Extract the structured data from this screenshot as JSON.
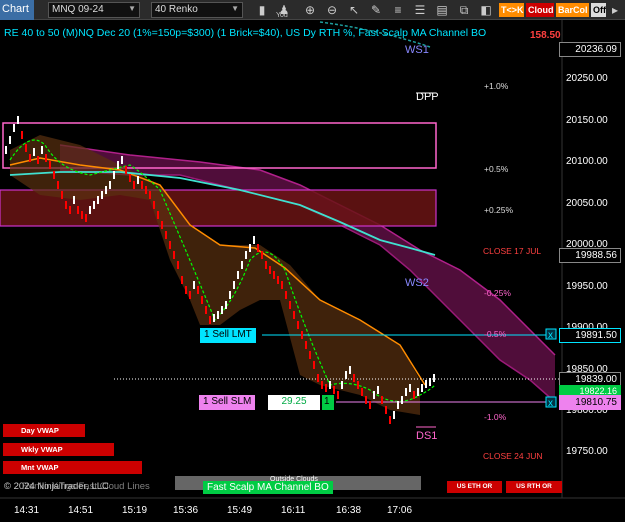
{
  "toolbar": {
    "chart_label": "Chart",
    "instrument": "MNQ 09-24",
    "bar_type": "40 Renko",
    "user_label": "You",
    "btn_tk": "T<>K",
    "btn_cloud": "Cloud",
    "btn_barcol": "BarCol",
    "btn_off": "Off"
  },
  "title": "RE 40 to 50 (M)NQ Dec 20 (1%=150p=$300) (1 Brick=$40), US Dy RTH %, Fast Scalp MA Channel BO",
  "title_price": "158.50",
  "price_axis": {
    "ticks": [
      "20250.00",
      "20200.00",
      "20150.00",
      "20100.00",
      "20050.00",
      "20000.00",
      "19950.00",
      "19900.00",
      "19850.00",
      "19800.00",
      "19750.00"
    ],
    "labels": [
      {
        "text": "20236.09",
        "bg": "#000000",
        "fg": "#ffffff",
        "border": "#888888"
      },
      {
        "text": "19988.56",
        "bg": "#000000",
        "fg": "#ffffff",
        "border": "#888888"
      },
      {
        "text": "19891.50",
        "bg": "#000000",
        "fg": "#ffffff",
        "border": "#00e5ff"
      },
      {
        "text": "19839.00",
        "bg": "#000000",
        "fg": "#ffffff",
        "border": "#888888"
      },
      {
        "text": "19822.16",
        "bg": "#00cc44",
        "fg": "#ffffff",
        "border": "#00cc44"
      },
      {
        "text": "19810.75",
        "bg": "#ee82ee",
        "fg": "#000000",
        "border": "#ee82ee"
      }
    ]
  },
  "time_axis": [
    "14:31",
    "14:51",
    "15:19",
    "15:36",
    "15:49",
    "16:11",
    "16:38",
    "17:06"
  ],
  "levels": {
    "ws1": "WS1",
    "dpp": "DPP",
    "ws2": "WS2",
    "ds1": "DS1",
    "p1": "+1.0%",
    "p05": "+0.5%",
    "p025": "+0.25%",
    "close17": "CLOSE 17 JUL",
    "m025": "-0.25%",
    "m05": "-0.5%",
    "m1": "-1.0%",
    "close24": "CLOSE 24 JUN"
  },
  "orders": {
    "sell_lmt": "1 Sell LMT",
    "sell_slm": "1 Sell SLM",
    "slm_price": "29.25",
    "slm_qty": "1"
  },
  "vwap_buttons": [
    "Day VWAP",
    "Wkly VWAP",
    "Mnt VWAP"
  ],
  "rth_buttons": [
    "US ETH OR",
    "US RTH OR"
  ],
  "status": {
    "outside_clouds": "Outside Clouds",
    "strategy": "Fast Scalp MA Channel BO",
    "copyright": "© 2024 NinjaTrader, LLC",
    "overlay_text": "Renko Kings Fast Cloud Lines"
  },
  "colors": {
    "background": "#000000",
    "title": "#00e5ff",
    "bull_brick": "#ffffff",
    "bear_brick": "#ff0000",
    "cloud_purple": "#8b1a6b",
    "ma_cyan": "#40e0d0",
    "ma_orange": "#ff8c00",
    "ma_green": "#00ff00",
    "box_pink": "#ff66cc",
    "zone_red": "#7a1a1a"
  }
}
